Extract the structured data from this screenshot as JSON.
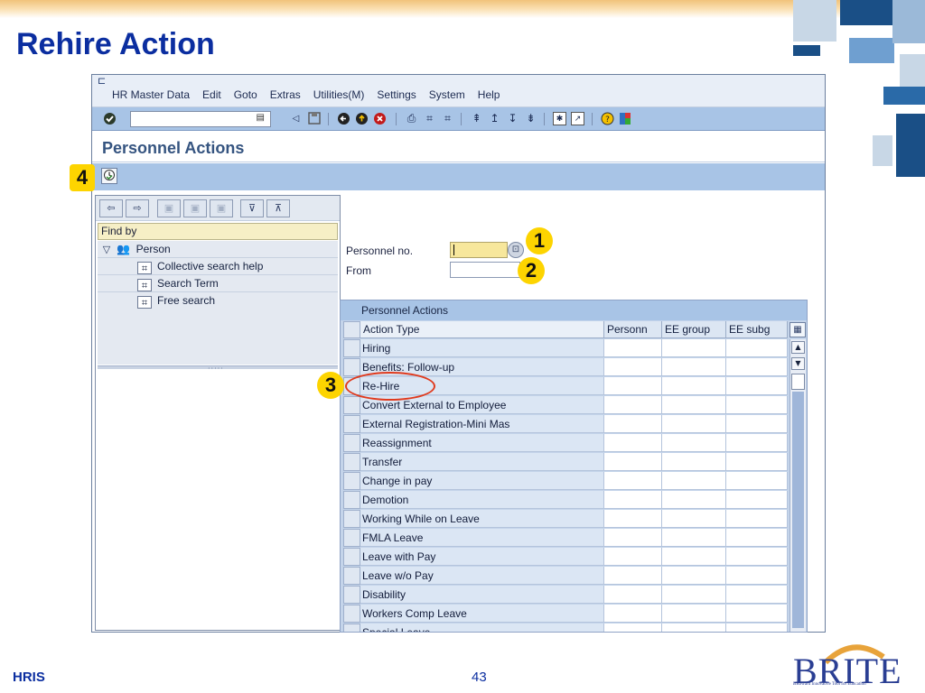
{
  "slide": {
    "title": "Rehire Action",
    "footer_left": "HRIS",
    "page_number": "43",
    "logo_text": "BRITE",
    "logo_subtitle": "BRoward Innovative Tool for Education"
  },
  "colors": {
    "title_blue": "#0b2ea0",
    "sap_toolbar": "#a8c4e6",
    "callout_yellow": "#fdd400",
    "highlight_red": "#e03a1d",
    "required_field": "#f7e79c"
  },
  "menu": {
    "items": [
      "HR Master Data",
      "Edit",
      "Goto",
      "Extras",
      "Utilities(M)",
      "Settings",
      "System",
      "Help"
    ]
  },
  "toolbar": {
    "icons": [
      "enter-icon",
      "back-icon",
      "save-icon",
      "back-green-icon",
      "exit-icon",
      "cancel-icon",
      "print-icon",
      "find-icon",
      "find-next-icon",
      "first-page-icon",
      "previous-page-icon",
      "next-page-icon",
      "last-page-icon",
      "create-session-icon",
      "shortcut-icon",
      "help-icon",
      "layout-icon"
    ]
  },
  "screen": {
    "title": "Personnel Actions"
  },
  "left_panel": {
    "find_by_label": "Find by",
    "root_label": "Person",
    "items": [
      {
        "label": "Collective search help",
        "icon": "binoculars-icon"
      },
      {
        "label": "Search Term",
        "icon": "binoculars-icon"
      },
      {
        "label": "Free search",
        "icon": "binoculars-icon"
      }
    ]
  },
  "fields": {
    "personnel_no_label": "Personnel no.",
    "personnel_no_value": "",
    "from_label": "From",
    "from_value": ""
  },
  "callouts": {
    "one": "1",
    "two": "2",
    "three": "3",
    "four": "4"
  },
  "table": {
    "title": "Personnel Actions",
    "columns": [
      "Action Type",
      "Personn",
      "EE group",
      "EE subg"
    ],
    "rows": [
      "Hiring",
      "Benefits: Follow-up",
      "Re-Hire",
      "Convert External to Employee",
      "External Registration-Mini Mas",
      "Reassignment",
      "Transfer",
      "Change in pay",
      "Demotion",
      "Working While on Leave",
      "FMLA Leave",
      "Leave with Pay",
      "Leave w/o Pay",
      "Disability",
      "Workers Comp Leave",
      "Special Leave"
    ],
    "highlighted_row": "Re-Hire"
  }
}
